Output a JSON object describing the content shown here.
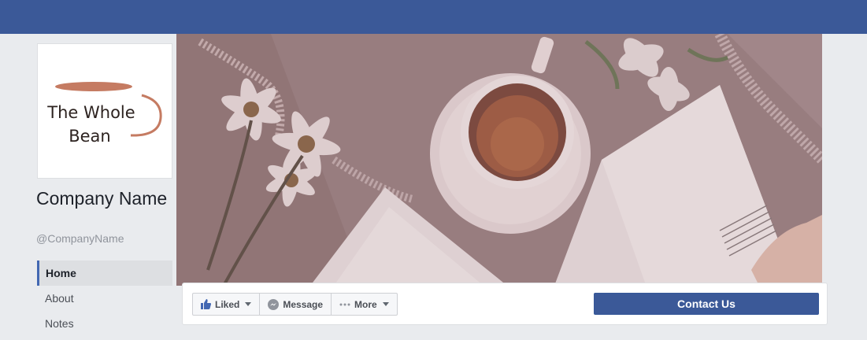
{
  "page": {
    "brand_color": "#3b5998",
    "logo_text_line1": "The Whole",
    "logo_text_line2": "Bean",
    "company_name": "Company Name",
    "handle": "@CompanyName"
  },
  "nav": {
    "items": [
      {
        "label": "Home",
        "active": true
      },
      {
        "label": "About",
        "active": false
      },
      {
        "label": "Notes",
        "active": false
      }
    ]
  },
  "actions": {
    "liked_label": "Liked",
    "message_label": "Message",
    "more_label": "More",
    "contact_label": "Contact Us"
  },
  "icons": {
    "like": "thumbs-up-icon",
    "message": "messenger-icon",
    "more": "ellipsis-icon"
  }
}
